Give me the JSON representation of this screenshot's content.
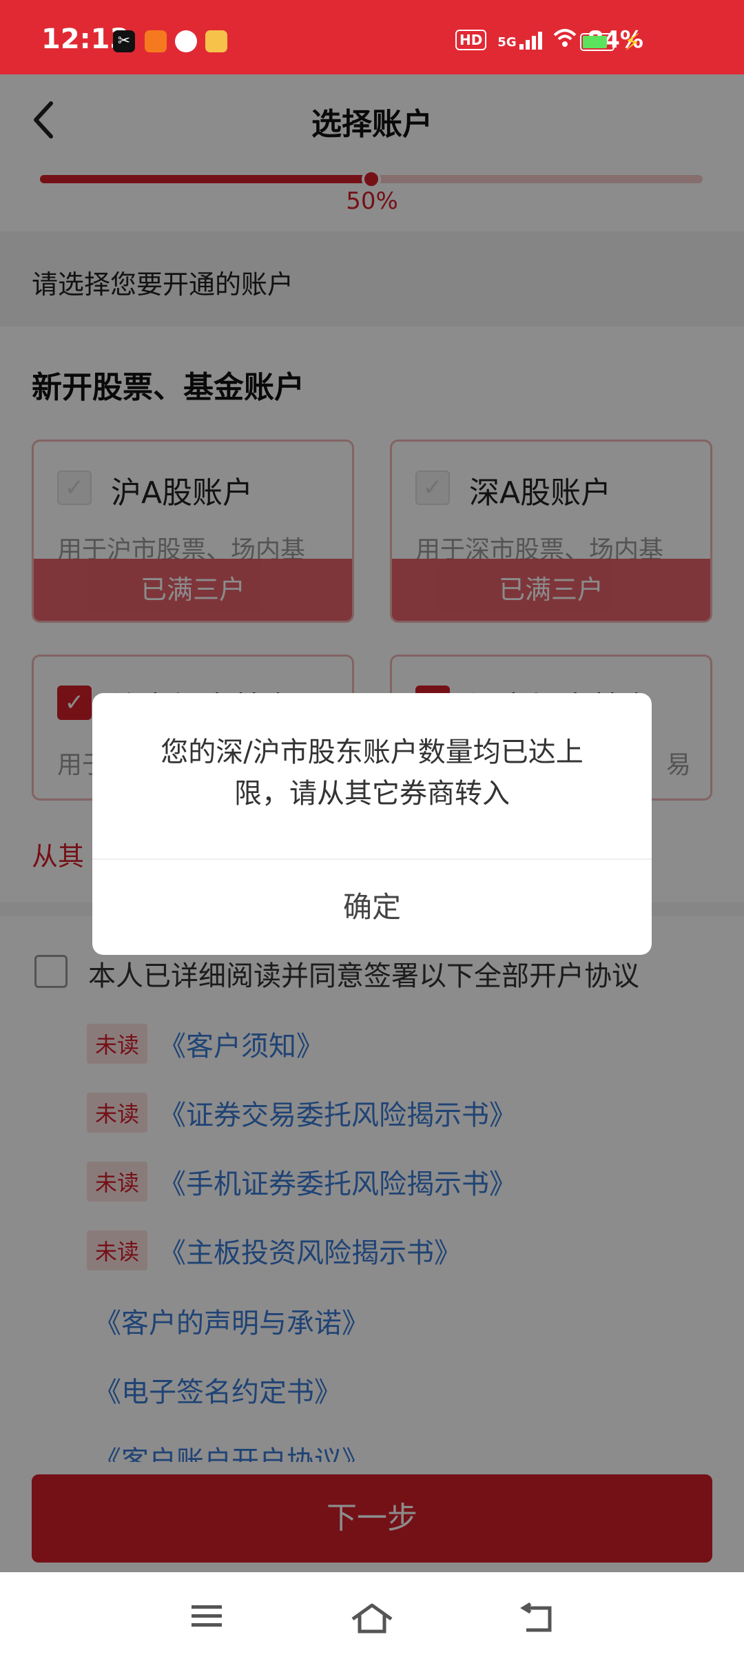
{
  "status_bar": {
    "time": "12:13",
    "hd": "HD",
    "network": "5G",
    "battery": "84%"
  },
  "header": {
    "title": "选择账户",
    "progress_text": "50%",
    "progress": 0.5
  },
  "hint": "请选择您要开通的账户",
  "section": {
    "title": "新开股票、基金账户",
    "cards": [
      {
        "name": "沪A股账户",
        "desc": "用于沪市股票、场内基",
        "status": "已满三户",
        "checked": false
      },
      {
        "name": "深A股账户",
        "desc": "用于深市股票、场内基",
        "status": "已满三户",
        "checked": false
      },
      {
        "name": "沪市场内基金",
        "desc": "用于",
        "checked": true
      },
      {
        "name": "深市场内基金",
        "desc": "易",
        "checked": true
      }
    ],
    "transfer_link": "从其"
  },
  "agreement": {
    "checkbox_label": "本人已详细阅读并同意签署以下全部开户协议",
    "unread_label": "未读",
    "docs": [
      {
        "title": "《客户须知》",
        "unread": true
      },
      {
        "title": "《证券交易委托风险揭示书》",
        "unread": true
      },
      {
        "title": "《手机证券委托风险揭示书》",
        "unread": true
      },
      {
        "title": "《主板投资风险揭示书》",
        "unread": true
      },
      {
        "title": "《客户的声明与承诺》",
        "unread": false
      },
      {
        "title": "《电子签名约定书》",
        "unread": false
      },
      {
        "title": "《客户账户开户协议》",
        "unread": false
      }
    ]
  },
  "next_button": "下一步",
  "dialog": {
    "message": "您的深/沪市股东账户数量均已达上限，请从其它券商转入",
    "confirm": "确定"
  },
  "colors": {
    "brand": "#d41f2a",
    "status_bar": "#e12934",
    "link": "#3a7bd5"
  }
}
